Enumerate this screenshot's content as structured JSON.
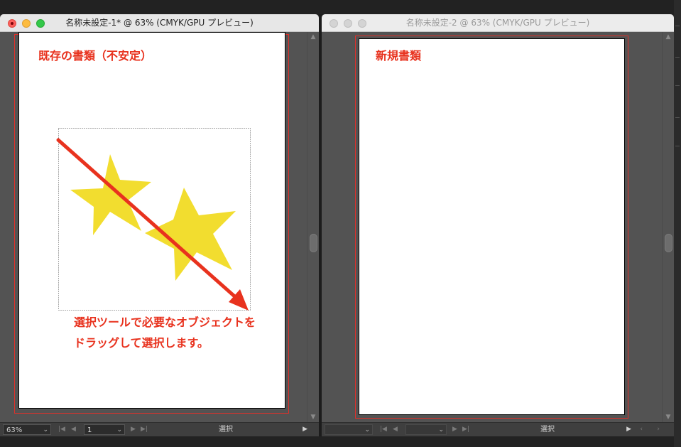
{
  "windows": [
    {
      "title": "名称未設定-1* @ 63% (CMYK/GPU プレビュー)",
      "zoom": "63%",
      "page": "1",
      "status": "選択"
    },
    {
      "title": "名称未設定-2 @ 63% (CMYK/GPU プレビュー)",
      "zoom": "",
      "page": "",
      "status": "選択"
    }
  ],
  "annotations": {
    "existing_doc": "既存の書類（不安定）",
    "new_doc": "新規書類",
    "instruction_line1": "選択ツールで必要なオブジェクトを",
    "instruction_line2": "ドラッグして選択します。"
  },
  "colors": {
    "star": "#f2dd2f",
    "arrow": "#e8321e",
    "bleed": "#e0302a"
  },
  "icons": [
    "close-icon",
    "minimize-icon",
    "maximize-icon",
    "star-shape",
    "drag-arrow",
    "first-page-icon",
    "prev-page-icon",
    "next-page-icon",
    "last-page-icon",
    "play-icon",
    "chevron-down-icon"
  ]
}
